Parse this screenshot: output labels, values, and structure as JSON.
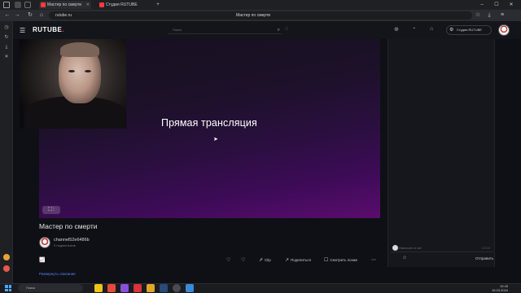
{
  "browser": {
    "tabs": [
      {
        "label": "Мастер по смерти"
      },
      {
        "label": "Студия RUTUBE"
      }
    ],
    "url": "rutube.ru",
    "page_title": "Мастер по смерти"
  },
  "header": {
    "logo_text": "RUTUBE",
    "search_placeholder": "Поиск",
    "studio_label": "Студия RUTUBE"
  },
  "player": {
    "overlay_text": "Прямая трансляция",
    "control_label": "⛶ ⋮"
  },
  "video": {
    "title": "Мастер по смерти",
    "channel_name": "channel52e6486b",
    "channel_sub": "0 подписчиков",
    "stats_icon": "📈",
    "actions": [
      {
        "icon": "♡",
        "label": ""
      },
      {
        "icon": "♡",
        "label": ""
      },
      {
        "icon": "⇗",
        "label": "Clip"
      },
      {
        "icon": "↗",
        "label": "Поделиться"
      },
      {
        "icon": "☐",
        "label": "Смотреть позже"
      },
      {
        "icon": "⋯",
        "label": ""
      }
    ],
    "description_more": "Развернуть описание"
  },
  "chat": {
    "input_placeholder": "Написать в чат",
    "counter": "0/200",
    "send_label": "Отправить"
  },
  "taskbar": {
    "search_placeholder": "Поиск",
    "time": "19:43",
    "date": "15.03.2024"
  },
  "colors": {
    "accent": "#ff2e4a",
    "player_gradient_end": "#5a0c6e",
    "link": "#5a83ff"
  }
}
